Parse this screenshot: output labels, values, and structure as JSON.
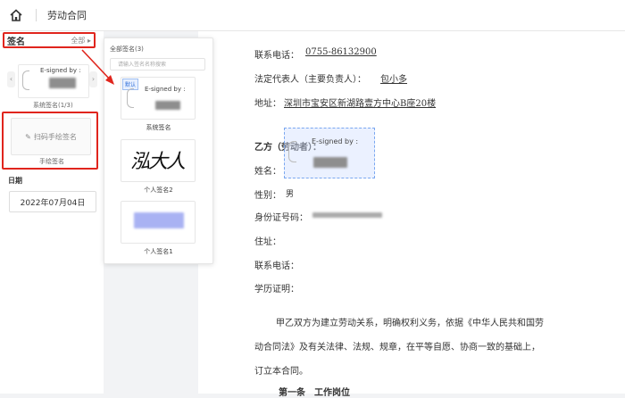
{
  "header": {
    "title": "劳动合同",
    "home_icon": "home-icon"
  },
  "left_panel": {
    "signature_title": "签名",
    "all_label": "全部",
    "system_sig_card_text": "E-signed by :",
    "system_sig_caption": "系统签名(1/3)",
    "scan_button_label": "扫码手绘签名",
    "scan_caption": "手绘签名",
    "date_title": "日期",
    "date_value": "2022年07月04日"
  },
  "popup": {
    "title": "全部签名(3)",
    "search_placeholder": "请输入签名名称搜索",
    "cards": [
      {
        "tag": "默认",
        "text": "E-signed by :",
        "caption": "系统签名"
      },
      {
        "handwriting": "泓大人",
        "caption": "个人签名2"
      },
      {
        "caption": "个人签名1"
      }
    ]
  },
  "document": {
    "line_phone_top": "联系电话：",
    "phone_top_value": "0755-86132900",
    "legal_rep_label": "法定代表人（主要负责人）：",
    "legal_rep_value": "包小多",
    "address_label": "地址：",
    "address_value": "深圳市宝安区新湖路壹方中心B座20楼",
    "party_b": "乙方（劳动者）：",
    "overlay_text": "E-signed by :",
    "name_label": "姓名：",
    "gender_label": "性别：",
    "gender_value": "男",
    "id_label": "身份证号码：",
    "residence_label": "住址：",
    "phone_label": "联系电话：",
    "edu_label": "学历证明：",
    "para1": "甲乙双方为建立劳动关系，明确权利义务，依据《中华人民共和国劳",
    "para2": "动合同法》及有关法律、法规、规章，在平等自愿、协商一致的基础上，",
    "para3": "订立本合同。",
    "article1": "第一条　工作岗位"
  },
  "colors": {
    "annotation_red": "#e0251d",
    "accent_blue": "#2f6fd8"
  }
}
